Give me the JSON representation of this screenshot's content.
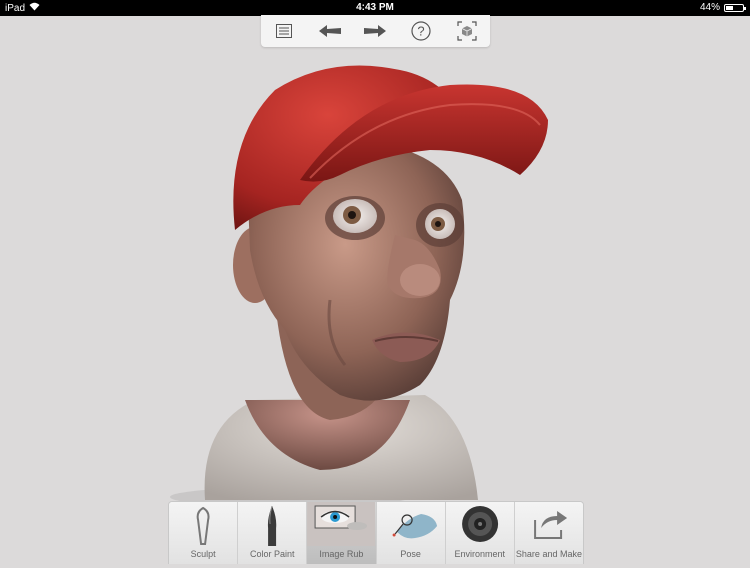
{
  "status_bar": {
    "device": "iPad",
    "time": "4:43 PM",
    "battery": "44%",
    "battery_level": 0.44
  },
  "top_toolbar": {
    "buttons": [
      {
        "icon": "list-icon"
      },
      {
        "icon": "undo-arrow-icon"
      },
      {
        "icon": "redo-arrow-icon"
      },
      {
        "icon": "help-icon",
        "glyph": "?"
      },
      {
        "icon": "frame-cube-icon"
      }
    ]
  },
  "palette": {
    "tools": [
      {
        "label": "Sculpt",
        "icon": "sculpt-tool-icon"
      },
      {
        "label": "Color Paint",
        "icon": "paint-brush-icon"
      },
      {
        "label": "Image Rub",
        "icon": "eye-photo-icon"
      },
      {
        "label": "Pose",
        "icon": "pose-hand-icon"
      },
      {
        "label": "Environment",
        "icon": "environment-sphere-icon"
      },
      {
        "label": "Share and Make",
        "icon": "share-arrow-icon"
      }
    ]
  },
  "colors": {
    "background": "#dcdada",
    "cap": "#c8322c",
    "skin": "#b58676",
    "shirt": "#d8d2cc"
  }
}
